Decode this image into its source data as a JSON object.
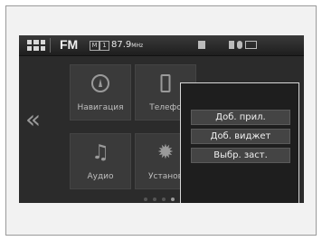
{
  "status_bar": {
    "source": "FM",
    "band_1": "M",
    "band_2": "1",
    "frequency": "87.9",
    "frequency_unit": "MHz"
  },
  "home_tiles": [
    {
      "label": "Навигация",
      "icon": "navigation-icon"
    },
    {
      "label": "Телефо",
      "icon": "phone-icon"
    },
    {
      "label": "Аудио",
      "icon": "music-note-icon"
    },
    {
      "label": "Установ",
      "icon": "gear-icon"
    }
  ],
  "left_arrow": "«",
  "popup_menu": {
    "items": [
      "Доб. прил.",
      "Доб. виджет",
      "Выбр. заст."
    ]
  },
  "page_indicator": {
    "count": 4,
    "active": 3
  }
}
